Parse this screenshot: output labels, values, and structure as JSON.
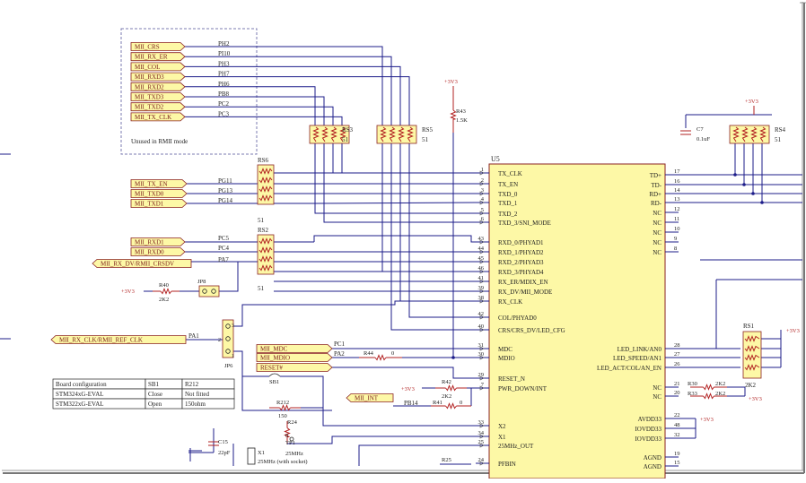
{
  "unused_box": {
    "note": "Unused in RMII mode",
    "signals": [
      "MII_CRS",
      "MII_RX_ER",
      "MII_COL",
      "MII_RXD3",
      "MII_RXD2",
      "MII_TXD3",
      "MII_TXD2",
      "MII_TX_CLK"
    ],
    "pins": [
      "PH2",
      "PI10",
      "PH3",
      "PH7",
      "PH6",
      "PB8",
      "PC2",
      "PC3"
    ]
  },
  "tx_ports": {
    "signals": [
      "MII_TX_EN",
      "MII_TXD0",
      "MII_TXD1"
    ],
    "pins": [
      "PG11",
      "PG13",
      "PG14"
    ]
  },
  "rx_ports": {
    "signals": [
      "MII_RXD1",
      "MII_RXD0",
      "MII_RX_DV/RMII_CRSDV"
    ],
    "pins": [
      "PC5",
      "PC4",
      "PA7"
    ]
  },
  "resistor_packs": {
    "rs6": {
      "ref": "RS6",
      "value": "51"
    },
    "rs2": {
      "ref": "RS2",
      "value": "51"
    },
    "rs3": {
      "ref": "RS3",
      "value": "51"
    },
    "rs5": {
      "ref": "RS5",
      "value": "51"
    },
    "rs4": {
      "ref": "RS4",
      "value": "51"
    },
    "rs1": {
      "ref": "RS1",
      "value": "2K2"
    }
  },
  "chip": {
    "ref": "U5",
    "left_pins": [
      {
        "num": "1",
        "name": "TX_CLK"
      },
      {
        "num": "2",
        "name": "TX_EN"
      },
      {
        "num": "3",
        "name": "TXD_0"
      },
      {
        "num": "4",
        "name": "TXD_1"
      },
      {
        "num": "5",
        "name": "TXD_2"
      },
      {
        "num": "6",
        "name": "TXD_3/SNI_MODE"
      },
      {
        "num": "43",
        "name": "RXD_0/PHYAD1"
      },
      {
        "num": "44",
        "name": "RXD_1/PHYAD2"
      },
      {
        "num": "45",
        "name": "RXD_2/PHYAD3"
      },
      {
        "num": "46",
        "name": "RXD_3/PHYAD4"
      },
      {
        "num": "41",
        "name": "RX_ER/MDIX_EN"
      },
      {
        "num": "39",
        "name": "RX_DV/MII_MODE"
      },
      {
        "num": "38",
        "name": "RX_CLK"
      },
      {
        "num": "42",
        "name": "COL/PHYAD0"
      },
      {
        "num": "40",
        "name": "CRS/CRS_DV/LED_CFG"
      },
      {
        "num": "31",
        "name": "MDC"
      },
      {
        "num": "30",
        "name": "MDIO"
      },
      {
        "num": "29",
        "name": "RESET_N"
      },
      {
        "num": "7",
        "name": "PWR_DOWN/INT"
      },
      {
        "num": "33",
        "name": "X2"
      },
      {
        "num": "34",
        "name": "X1"
      },
      {
        "num": "25",
        "name": "25MHz_OUT"
      },
      {
        "num": "24",
        "name": "PFBIN"
      }
    ],
    "right_pins": [
      {
        "num": "17",
        "name": "TD+"
      },
      {
        "num": "16",
        "name": "TD-"
      },
      {
        "num": "14",
        "name": "RD+"
      },
      {
        "num": "13",
        "name": "RD-"
      },
      {
        "num": "12",
        "name": "NC"
      },
      {
        "num": "11",
        "name": "NC"
      },
      {
        "num": "10",
        "name": "NC"
      },
      {
        "num": "9",
        "name": "NC"
      },
      {
        "num": "8",
        "name": "NC"
      },
      {
        "num": "28",
        "name": "LED_LINK/AN0"
      },
      {
        "num": "27",
        "name": "LED_SPEED/AN1"
      },
      {
        "num": "26",
        "name": "LED_ACT/COL/AN_EN"
      },
      {
        "num": "21",
        "name": "NC"
      },
      {
        "num": "20",
        "name": "NC"
      },
      {
        "num": "22",
        "name": "AVDD33"
      },
      {
        "num": "48",
        "name": "IOVDD33"
      },
      {
        "num": "32",
        "name": "IOVDD33"
      },
      {
        "num": "19",
        "name": "AGND"
      },
      {
        "num": "15",
        "name": "AGND"
      }
    ]
  },
  "mgmt": {
    "signals": [
      "MII_MDC",
      "MII_MDIO",
      "RESET#",
      "MII_INT"
    ],
    "pins": [
      "PC1",
      "PA2",
      "PB14"
    ],
    "r44": {
      "ref": "R44",
      "value": "0"
    }
  },
  "misc": {
    "rx_clk_label": "MII_RX_CLK/RMII_REF_CLK",
    "pa1": "PA1",
    "jp6": "JP6",
    "jp8": "JP8",
    "r40": {
      "ref": "R40",
      "value": "2K2"
    },
    "r42": {
      "ref": "R42",
      "value": "2K2"
    },
    "r41": {
      "ref": "R41",
      "value": "0"
    },
    "r43": {
      "ref": "R43",
      "value": "1.5K"
    },
    "sb1": "SB1",
    "r212": {
      "ref": "R212",
      "value": "150"
    },
    "r24": {
      "ref": "R24",
      "value": "0"
    },
    "tp1": "TP1",
    "tp1_freq": "25MHz",
    "c15": {
      "ref": "C15",
      "value": "22pF"
    },
    "x1": {
      "ref": "X1",
      "value": "25MHz (with socket)"
    },
    "r25": "R25",
    "c7": {
      "ref": "C7",
      "value": "0.1uF"
    },
    "r30": {
      "ref": "R30",
      "value": "2K2"
    },
    "r33": {
      "ref": "R33",
      "value": "2K2"
    },
    "vcc": "+3V3"
  },
  "config_table": {
    "rows": [
      [
        "Board configuration",
        "SB1",
        "R212"
      ],
      [
        "STM324xG-EVAL",
        "Close",
        "Not fitted"
      ],
      [
        "STM322xG-EVAL",
        "Open",
        "150ohm"
      ]
    ]
  }
}
